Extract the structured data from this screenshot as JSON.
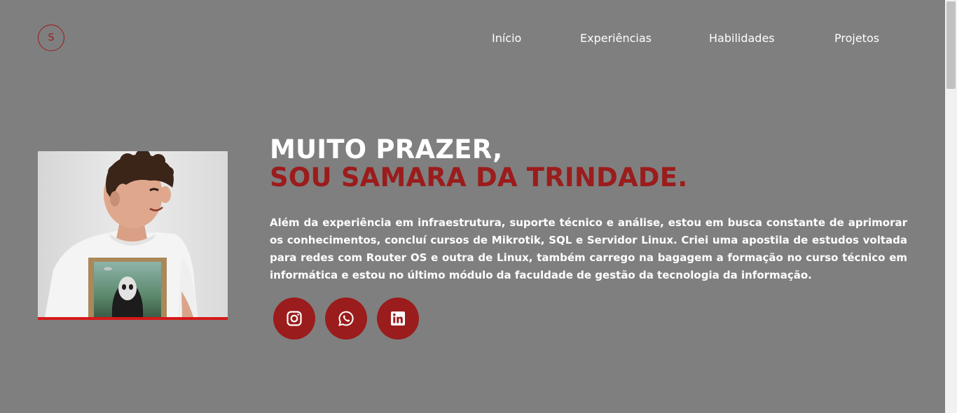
{
  "logo": {
    "letter": "S"
  },
  "nav": {
    "items": [
      {
        "label": "Início"
      },
      {
        "label": "Experiências"
      },
      {
        "label": "Habilidades"
      },
      {
        "label": "Projetos"
      }
    ]
  },
  "hero": {
    "line1": "MUITO PRAZER,",
    "line2": "SOU SAMARA DA TRINDADE.",
    "about": "Além da experiência em infraestrutura, suporte técnico e análise, estou em busca constante de aprimorar os conhecimentos, concluí cursos de Mikrotik, SQL e Servidor Linux. Criei uma apostila de estudos voltada para redes com Router OS e outra de Linux, também carrego na bagagem a formação no curso técnico em informática e estou no último módulo da faculdade de gestão da tecnologia da informação."
  },
  "socials": [
    {
      "icon": "instagram-icon"
    },
    {
      "icon": "whatsapp-icon"
    },
    {
      "icon": "linkedin-icon"
    }
  ],
  "colors": {
    "background": "#7f7f7f",
    "accent": "#9b1c1c",
    "underline": "#d61818",
    "text": "#ffffff"
  }
}
